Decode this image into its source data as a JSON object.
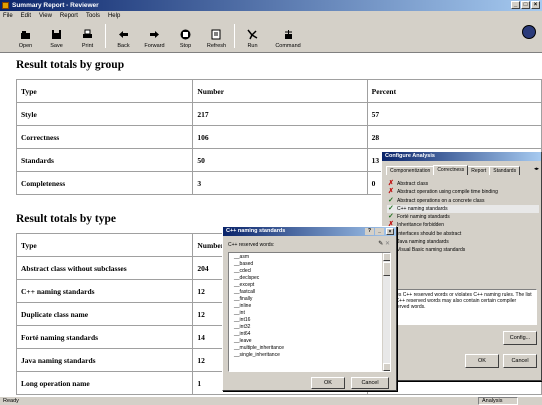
{
  "window": {
    "title": "Summary Report - Reviewer"
  },
  "menu": [
    "File",
    "Edit",
    "View",
    "Report",
    "Tools",
    "Help"
  ],
  "toolbar": [
    {
      "label": "Open",
      "icon": "open-icon"
    },
    {
      "label": "Save",
      "icon": "save-icon"
    },
    {
      "label": "Print",
      "icon": "print-icon"
    },
    {
      "label": "Back",
      "icon": "back-icon"
    },
    {
      "label": "Forward",
      "icon": "forward-icon"
    },
    {
      "label": "Stop",
      "icon": "stop-icon"
    },
    {
      "label": "Refresh",
      "icon": "refresh-icon"
    },
    {
      "label": "Run",
      "icon": "run-icon"
    },
    {
      "label": "Command",
      "icon": "command-icon"
    }
  ],
  "group_section": {
    "heading": "Result totals by group",
    "headers": [
      "Type",
      "Number",
      "Percent"
    ],
    "rows": [
      [
        "Style",
        "217",
        "57"
      ],
      [
        "Correctness",
        "106",
        "28"
      ],
      [
        "Standards",
        "50",
        "13"
      ],
      [
        "Completeness",
        "3",
        "0"
      ]
    ]
  },
  "type_section": {
    "heading": "Result totals by type",
    "headers": [
      "Type",
      "Number",
      ""
    ],
    "rows": [
      [
        "Abstract class without subclasses",
        "204",
        ""
      ],
      [
        "C++ naming standards",
        "12",
        ""
      ],
      [
        "Duplicate class name",
        "12",
        ""
      ],
      [
        "Forté naming standards",
        "14",
        ""
      ],
      [
        "Java naming standards",
        "12",
        ""
      ],
      [
        "Long operation name",
        "1",
        ""
      ]
    ]
  },
  "status": {
    "left": "Ready",
    "right": "Analysis"
  },
  "configure_dialog": {
    "title": "Configure Analysis",
    "tabs": [
      "Componentization",
      "Correctness",
      "Report",
      "Standards"
    ],
    "active_tab": "Correctness",
    "tab_scroll": "◂▸",
    "rules": [
      {
        "label": "Abstract class",
        "checked": false
      },
      {
        "label": "Abstract operation using compile time binding",
        "checked": false
      },
      {
        "label": "Abstract operations on a concrete class",
        "checked": true
      },
      {
        "label": "C++ naming standards",
        "checked": true
      },
      {
        "label": "Forté naming standards",
        "checked": true
      },
      {
        "label": "Inheritance forbidden",
        "checked": false
      },
      {
        "label": "Interfaces should be abstract",
        "checked": true
      },
      {
        "label": "Java naming standards",
        "checked": true
      },
      {
        "label": "Visual Basic naming standards",
        "checked": true
      }
    ],
    "description": "Uses C++ reserved words or violates C++ naming rules. The list of C++ reserved words may also contain certain compiler reserved words.",
    "config_button": "Config...",
    "ok_button": "OK",
    "cancel_button": "Cancel"
  },
  "cpp_dialog": {
    "title": "C++ naming standards",
    "list_label": "C++ reserved words:",
    "keywords": [
      "__asm",
      "__based",
      "__cdecl",
      "__declspec",
      "__except",
      "__fastcall",
      "__finally",
      "__inline",
      "__int",
      "__int16",
      "__int32",
      "__int64",
      "__leave",
      "__multiple_inheritance",
      "__single_inheritance"
    ],
    "ok_button": "OK",
    "cancel_button": "Cancel",
    "title_buttons": [
      "?",
      "_"
    ]
  },
  "colors": {
    "titlebar_start": "#0a246a",
    "titlebar_end": "#a6caf0",
    "chrome": "#d4d0c8",
    "check_ok": "#207020",
    "check_no": "#c01010"
  }
}
